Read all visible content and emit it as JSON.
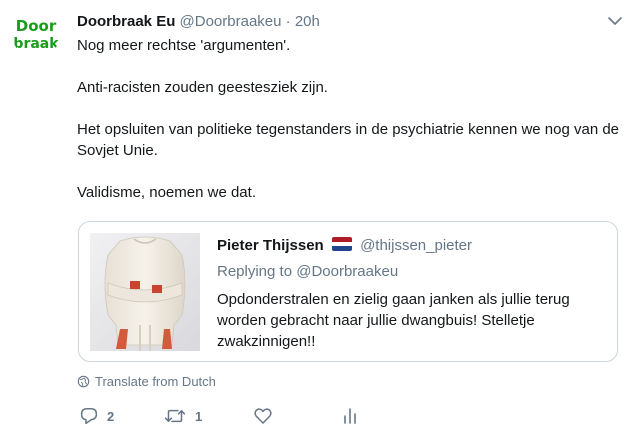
{
  "tweet": {
    "author": {
      "name": "Doorbraak Eu",
      "handle": "@Doorbraakeu",
      "avatar_text_top": "Door",
      "avatar_text_bottom": "braak"
    },
    "separator": "·",
    "time": "20h",
    "paragraphs": [
      "Nog meer rechtse 'argumenten'.",
      "Anti-racisten zouden geestesziek zijn.",
      "Het opsluiten van politieke tegenstanders in de psychiatrie kennen we nog van de Sovjet Unie.",
      "Validisme, noemen we dat."
    ],
    "quoted": {
      "name": "Pieter Thijssen",
      "handle": "@thijssen_pieter",
      "replying_prefix": "Replying to",
      "replying_handle": "@Doorbraakeu",
      "text": "Opdonderstralen en zielig gaan janken als jullie terug worden gebracht naar jullie dwangbuis! Stelletje zwakzinnigen!!",
      "flag_colors": [
        "#ae1c28",
        "#ffffff",
        "#21468b"
      ]
    },
    "translate_label": "Translate from Dutch",
    "actions": {
      "reply_count": "2",
      "retweet_count": "1",
      "like_count": "",
      "analytics_icon": "bar-chart-icon"
    }
  },
  "colors": {
    "text": "#14171a",
    "muted": "#657786",
    "border": "#ccd6dd",
    "brand_green": "#1a9c1a"
  }
}
